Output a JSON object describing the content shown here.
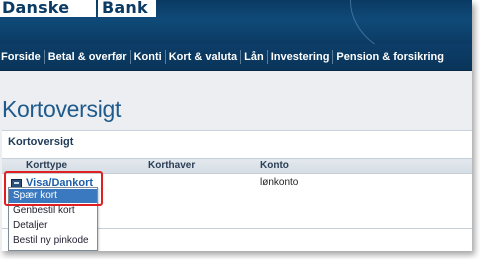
{
  "header": {
    "logo_word1": "Danske",
    "logo_word2": "Bank",
    "colors": {
      "header_bg": "#0b3b64",
      "title": "#1f5a8c",
      "link": "#1f5fa8",
      "highlight": "#e02020",
      "selected": "#3a79bf"
    }
  },
  "nav": {
    "items": [
      {
        "label": "Forside"
      },
      {
        "label": "Betal & overfør"
      },
      {
        "label": "Konti"
      },
      {
        "label": "Kort & valuta"
      },
      {
        "label": "Lån"
      },
      {
        "label": "Investering"
      },
      {
        "label": "Pension & forsikring"
      }
    ],
    "active": "Kort & valuta"
  },
  "page": {
    "title": "Kortoversigt"
  },
  "panel": {
    "title": "Kortoversigt",
    "columns": [
      "Korttype",
      "Korthaver",
      "Konto"
    ],
    "rows": [
      {
        "korttype": "Visa/Dankort",
        "korthaver": "",
        "konto": "lønkonto",
        "icon": "card-icon"
      }
    ]
  },
  "context_menu": {
    "items": [
      {
        "label": "Spær kort",
        "selected": true
      },
      {
        "label": "Genbestil kort",
        "selected": false
      },
      {
        "label": "Detaljer",
        "selected": false
      },
      {
        "label": "Bestil ny pinkode",
        "selected": false
      }
    ]
  }
}
